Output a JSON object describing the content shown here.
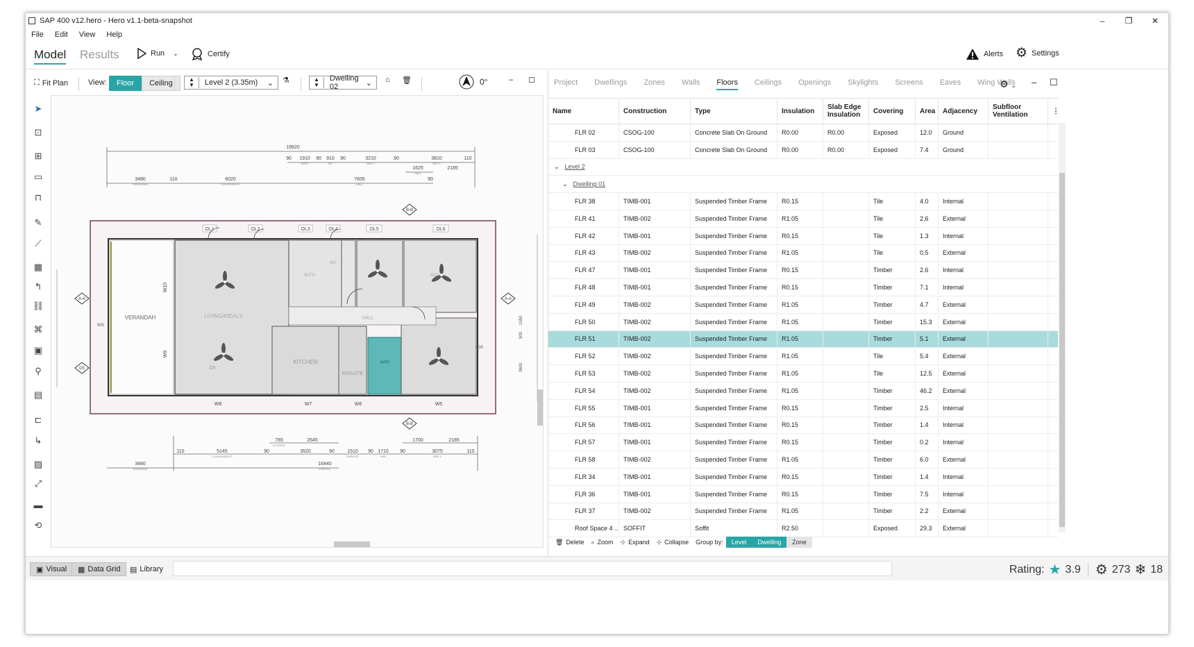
{
  "window": {
    "title": "SAP 400 v12.hero - Hero v1.1-beta-snapshot",
    "controls": {
      "minimize": "–",
      "restore": "❐",
      "close": "✕"
    }
  },
  "menu": [
    "File",
    "Edit",
    "View",
    "Help"
  ],
  "ribbon": {
    "tab_model": "Model",
    "tab_results": "Results",
    "run_label": "Run",
    "certify_label": "Certify",
    "alerts_label": "Alerts",
    "settings_label": "Settings"
  },
  "toolbar": {
    "fit_plan": "Fit Plan",
    "view_label": "View:",
    "floor": "Floor",
    "ceiling": "Ceiling",
    "level_value": "Level 2 (3.35m)",
    "dwelling_value": "Dwelling 02",
    "north_angle": "0°"
  },
  "plan": {
    "dims_top": [
      "19920",
      "90",
      "1910",
      "90",
      "910",
      "90",
      "3210",
      "90",
      "3810",
      "110",
      "1625",
      "2185",
      "3480",
      "110",
      "6020",
      "7835",
      "90"
    ],
    "dims_top_small": [
      "BATH",
      "WC",
      "BED 2",
      "BED 1",
      "HALL",
      "VERANDAH",
      "LIVING/MEALS",
      "HALL"
    ],
    "dims_bottom": [
      "785",
      "2645",
      "1700",
      "2185",
      "110",
      "5145",
      "90",
      "3520",
      "90",
      "1510",
      "90",
      "1710",
      "90",
      "3075",
      "110",
      "3480",
      "16440"
    ],
    "dims_bottom_small": [
      "KITCHEN",
      "ENSUITE",
      "WIR",
      "BED 4",
      "LIVING/MEALS",
      "VERANDAH",
      "OVERALL"
    ],
    "rooms": {
      "verandah": "VERANDAH",
      "living": "LIVING/MEALS",
      "kitchen": "KITCHEN",
      "ensuite": "ENSUITE",
      "wir": "WIR",
      "hall": "HALL",
      "bath": "BATH",
      "wc": "WC",
      "bed": "BED"
    },
    "openings": [
      "OL1",
      "OL2",
      "OL3",
      "OL4",
      "OL5",
      "OL6",
      "W10",
      "W9",
      "W8",
      "W7",
      "W6",
      "W5",
      "D5"
    ],
    "section_markers": [
      "B-B",
      "B-B",
      "A-A",
      "A-A",
      "D5"
    ],
    "side_dims": [
      "900",
      "1550",
      "900",
      "3600",
      "900"
    ]
  },
  "data_tabs": [
    "Project",
    "Dwellings",
    "Zones",
    "Walls",
    "Floors",
    "Ceilings",
    "Openings",
    "Skylights",
    "Screens",
    "Eaves",
    "Wing Walls"
  ],
  "grid": {
    "headers": [
      "Name",
      "Construction",
      "Type",
      "Insulation",
      "Slab Edge Insulation",
      "Covering",
      "Area",
      "Adjacency",
      "Subfloor Ventilation"
    ],
    "rows": [
      {
        "name": "FLR 02",
        "construction": "CSOG-100",
        "type": "Concrete Slab On Ground",
        "insulation": "R0.00",
        "slab_edge": "R0.00",
        "covering": "Exposed",
        "area": "12.0",
        "adjacency": "Ground"
      },
      {
        "name": "FLR 03",
        "construction": "CSOG-100",
        "type": "Concrete Slab On Ground",
        "insulation": "R0.00",
        "slab_edge": "R0.00",
        "covering": "Exposed",
        "area": "7.4",
        "adjacency": "Ground"
      },
      {
        "group": "Level 2",
        "indent": 0
      },
      {
        "group": "Dwelling 01",
        "indent": 1
      },
      {
        "name": "FLR 38",
        "construction": "TIMB-001",
        "type": "Suspended Timber Frame",
        "insulation": "R0.15",
        "slab_edge": "",
        "covering": "Tile",
        "area": "4.0",
        "adjacency": "Internal"
      },
      {
        "name": "FLR 41",
        "construction": "TIMB-002",
        "type": "Suspended Timber Frame",
        "insulation": "R1.05",
        "slab_edge": "",
        "covering": "Tile",
        "area": "2.6",
        "adjacency": "External"
      },
      {
        "name": "FLR 42",
        "construction": "TIMB-001",
        "type": "Suspended Timber Frame",
        "insulation": "R0.15",
        "slab_edge": "",
        "covering": "Tile",
        "area": "1.3",
        "adjacency": "Internal"
      },
      {
        "name": "FLR 43",
        "construction": "TIMB-002",
        "type": "Suspended Timber Frame",
        "insulation": "R1.05",
        "slab_edge": "",
        "covering": "Tile",
        "area": "0.5",
        "adjacency": "External"
      },
      {
        "name": "FLR 47",
        "construction": "TIMB-001",
        "type": "Suspended Timber Frame",
        "insulation": "R0.15",
        "slab_edge": "",
        "covering": "Timber",
        "area": "2.6",
        "adjacency": "Internal"
      },
      {
        "name": "FLR 48",
        "construction": "TIMB-001",
        "type": "Suspended Timber Frame",
        "insulation": "R0.15",
        "slab_edge": "",
        "covering": "Timber",
        "area": "7.1",
        "adjacency": "Internal"
      },
      {
        "name": "FLR 49",
        "construction": "TIMB-002",
        "type": "Suspended Timber Frame",
        "insulation": "R1.05",
        "slab_edge": "",
        "covering": "Timber",
        "area": "4.7",
        "adjacency": "External"
      },
      {
        "name": "FLR 50",
        "construction": "TIMB-002",
        "type": "Suspended Timber Frame",
        "insulation": "R1.05",
        "slab_edge": "",
        "covering": "Timber",
        "area": "15.3",
        "adjacency": "External"
      },
      {
        "name": "FLR 51",
        "construction": "TIMB-002",
        "type": "Suspended Timber Frame",
        "insulation": "R1.05",
        "slab_edge": "",
        "covering": "Timber",
        "area": "5.1",
        "adjacency": "External",
        "selected": true
      },
      {
        "name": "FLR 52",
        "construction": "TIMB-002",
        "type": "Suspended Timber Frame",
        "insulation": "R1.05",
        "slab_edge": "",
        "covering": "Tile",
        "area": "5.4",
        "adjacency": "External"
      },
      {
        "name": "FLR 53",
        "construction": "TIMB-002",
        "type": "Suspended Timber Frame",
        "insulation": "R1.05",
        "slab_edge": "",
        "covering": "Tile",
        "area": "12.5",
        "adjacency": "External"
      },
      {
        "name": "FLR 54",
        "construction": "TIMB-002",
        "type": "Suspended Timber Frame",
        "insulation": "R1.05",
        "slab_edge": "",
        "covering": "Timber",
        "area": "46.2",
        "adjacency": "External"
      },
      {
        "name": "FLR 55",
        "construction": "TIMB-001",
        "type": "Suspended Timber Frame",
        "insulation": "R0.15",
        "slab_edge": "",
        "covering": "Timber",
        "area": "2.5",
        "adjacency": "Internal"
      },
      {
        "name": "FLR 56",
        "construction": "TIMB-001",
        "type": "Suspended Timber Frame",
        "insulation": "R0.15",
        "slab_edge": "",
        "covering": "Timber",
        "area": "1.4",
        "adjacency": "Internal"
      },
      {
        "name": "FLR 57",
        "construction": "TIMB-001",
        "type": "Suspended Timber Frame",
        "insulation": "R0.15",
        "slab_edge": "",
        "covering": "Timber",
        "area": "0.2",
        "adjacency": "Internal"
      },
      {
        "name": "FLR 58",
        "construction": "TIMB-002",
        "type": "Suspended Timber Frame",
        "insulation": "R1.05",
        "slab_edge": "",
        "covering": "Timber",
        "area": "6.0",
        "adjacency": "External"
      },
      {
        "name": "FLR 34",
        "construction": "TIMB-001",
        "type": "Suspended Timber Frame",
        "insulation": "R0.15",
        "slab_edge": "",
        "covering": "Timber",
        "area": "1.4",
        "adjacency": "Internal"
      },
      {
        "name": "FLR 36",
        "construction": "TIMB-001",
        "type": "Suspended Timber Frame",
        "insulation": "R0.15",
        "slab_edge": "",
        "covering": "Timber",
        "area": "7.5",
        "adjacency": "Internal"
      },
      {
        "name": "FLR 37",
        "construction": "TIMB-002",
        "type": "Suspended Timber Frame",
        "insulation": "R1.05",
        "slab_edge": "",
        "covering": "Timber",
        "area": "2.2",
        "adjacency": "External"
      },
      {
        "name": "Roof Space 4 ...",
        "construction": "SOFFIT",
        "type": "Soffit",
        "insulation": "R2.50",
        "slab_edge": "",
        "covering": "Exposed",
        "area": "29.3",
        "adjacency": "External"
      }
    ]
  },
  "grid_footer": {
    "delete": "Delete",
    "zoom": "Zoom",
    "expand": "Expand",
    "collapse": "Collapse",
    "group_by": "Group by:",
    "level": "Level",
    "dwelling": "Dwelling",
    "zone": "Zone"
  },
  "status": {
    "visual": "Visual",
    "data_grid": "Data Grid",
    "library": "Library",
    "rating_label": "Rating:",
    "rating_value": "3.9",
    "heating": "273",
    "cooling": "18"
  },
  "colors": {
    "accent": "#2aa5a5",
    "selected_row": "#a8dcdc",
    "wir_fill": "#5fb8b8",
    "outline": "#7b4a5a"
  },
  "icons": [
    "arrow-icon",
    "run-icon",
    "certify-icon",
    "alert-icon",
    "gear-icon",
    "star-icon",
    "snowflake-icon",
    "north-arrow-icon"
  ]
}
